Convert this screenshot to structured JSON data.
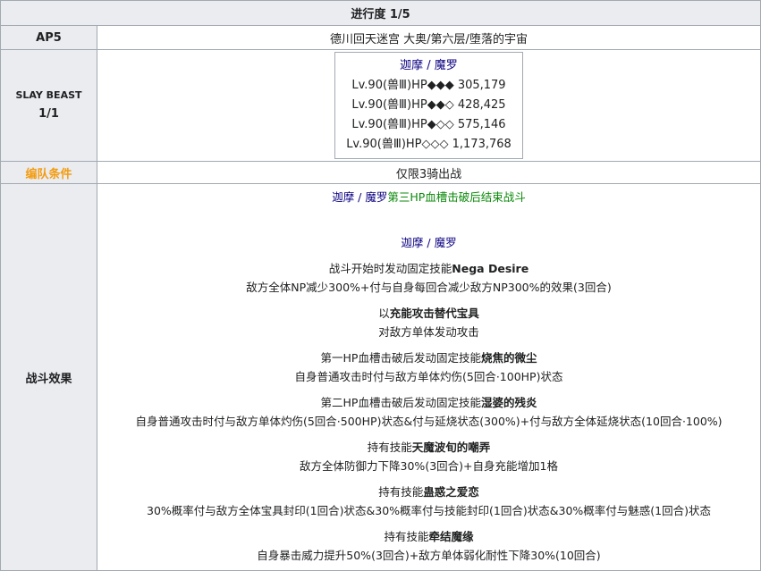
{
  "header": {
    "progress": "进行度 1/5"
  },
  "ap": {
    "label": "AP5",
    "location": "德川回天迷宫 大奥/第六层/堕落的宇宙"
  },
  "slay": {
    "label_line1": "SLAY BEAST",
    "label_line2": "1/1",
    "enemy_name": "迦摩 / 魔罗",
    "enemies": [
      "Lv.90(兽Ⅲ)HP◆◆◆ 305,179",
      "Lv.90(兽Ⅲ)HP◆◆◇ 428,425",
      "Lv.90(兽Ⅲ)HP◆◇◇ 575,146",
      "Lv.90(兽Ⅲ)HP◇◇◇ 1,173,768"
    ]
  },
  "formation": {
    "label": "编队条件",
    "value": "仅限3骑出战"
  },
  "battle": {
    "label": "战斗效果",
    "intro_name": "迦摩 / 魔罗",
    "intro_text": "第三HP血槽击破后结束战斗",
    "enemy_name": "迦摩 / 魔罗",
    "b1_prefix": "战斗开始时发动固定技能",
    "b1_skill": "Nega Desire",
    "b1_desc": "敌方全体NP减少300%+付与自身每回合减少敌方NP300%的效果(3回合)",
    "b2_prefix": "以",
    "b2_skill": "充能攻击替代宝具",
    "b2_desc": "对敌方单体发动攻击",
    "b3_prefix": "第一HP血槽击破后发动固定技能",
    "b3_skill": "烧焦的微尘",
    "b3_desc": "自身普通攻击时付与敌方单体灼伤(5回合·100HP)状态",
    "b4_prefix": "第二HP血槽击破后发动固定技能",
    "b4_skill": "湿婆的残炎",
    "b4_desc": "自身普通攻击时付与敌方单体灼伤(5回合·500HP)状态&付与延烧状态(300%)+付与敌方全体延烧状态(10回合·100%)",
    "b5_prefix": "持有技能",
    "b5_skill": "天魔波旬的嘲弄",
    "b5_desc": "敌方全体防御力下降30%(3回合)+自身充能增加1格",
    "b6_prefix": "持有技能",
    "b6_skill": "蛊惑之爱恋",
    "b6_desc": "30%概率付与敌方全体宝具封印(1回合)状态&30%概率付与技能封印(1回合)状态&30%概率付与魅惑(1回合)状态",
    "b7_prefix": "持有技能",
    "b7_skill": "牵结魔缘",
    "b7_desc": "自身暴击威力提升50%(3回合)+敌方单体弱化耐性下降30%(10回合)"
  }
}
